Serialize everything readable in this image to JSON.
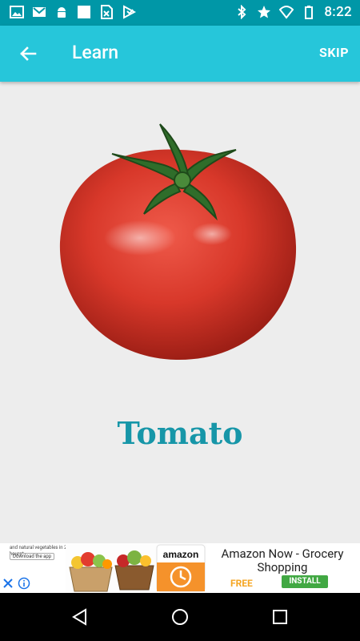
{
  "status_bar": {
    "time": "8:22",
    "left_icons": [
      "image-icon",
      "gmail-icon",
      "android-icon",
      "blank-notification-icon",
      "sheets-icon",
      "play-store-icon"
    ],
    "right_icons": [
      "bluetooth-icon",
      "star-icon",
      "wifi-icon",
      "battery-icon"
    ]
  },
  "app_bar": {
    "title": "Learn",
    "skip_label": "SKIP"
  },
  "card": {
    "image_alt": "tomato",
    "label": "Tomato"
  },
  "ad": {
    "small_text": "and natural vegetables in 2 hours*",
    "small_cta": "Download the app",
    "brand": "amazon",
    "title": "Amazon Now - Grocery Shopping",
    "price": "FREE",
    "install_label": "INSTALL"
  },
  "colors": {
    "status_bar": "#0097a7",
    "app_bar": "#26c6da",
    "label": "#1796a8",
    "install": "#41a843",
    "price": "#f5a623"
  }
}
